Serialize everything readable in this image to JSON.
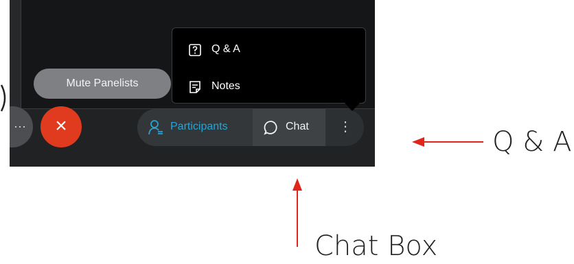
{
  "toolbar": {
    "mute_label": "Mute Panelists",
    "more_glyph": "···",
    "leave_glyph": "×",
    "participants_label": "Participants",
    "chat_label": "Chat",
    "more_options_glyph": "⋮"
  },
  "menu": {
    "items": [
      {
        "label": "Q & A",
        "icon": "question-box-icon"
      },
      {
        "label": "Notes",
        "icon": "notes-icon"
      }
    ]
  },
  "annotations": {
    "qa": "Q & A",
    "chat": "Chat Box",
    "arrow_color": "#e0251b"
  },
  "colors": {
    "participants_accent": "#25a5d6",
    "leave_red": "#e03a1f"
  }
}
